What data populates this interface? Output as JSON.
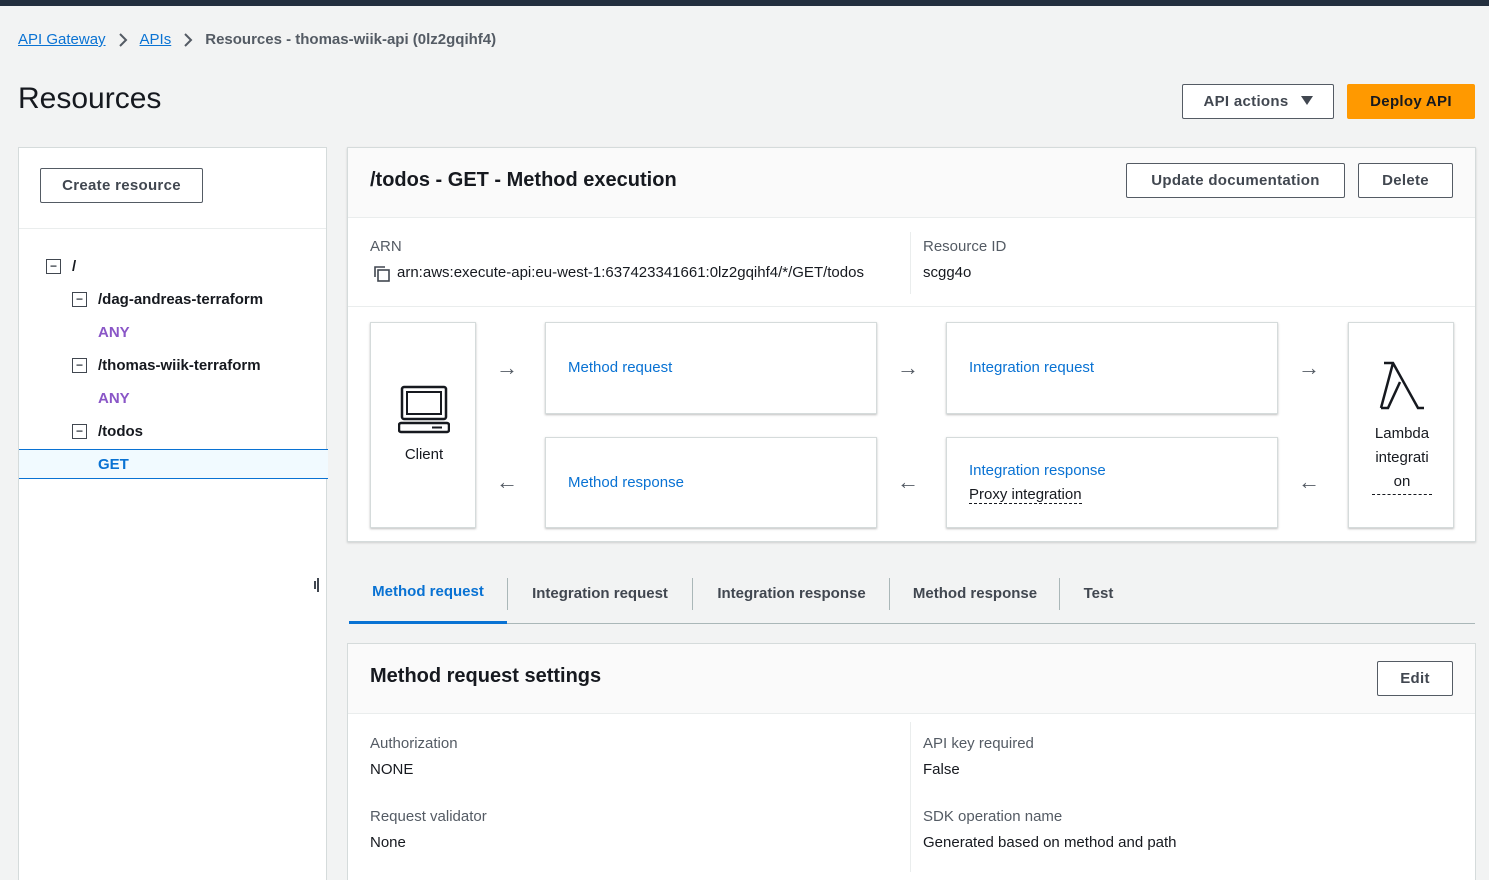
{
  "breadcrumb": {
    "items": [
      "API Gateway",
      "APIs"
    ],
    "current": "Resources - thomas-wiik-api (0lz2gqihf4)"
  },
  "page": {
    "title": "Resources",
    "api_actions_label": "API actions",
    "deploy_label": "Deploy API"
  },
  "sidebar": {
    "create_resource_label": "Create resource",
    "tree": [
      {
        "label": "/",
        "type": "resource"
      },
      {
        "label": "/dag-andreas-terraform",
        "type": "resource"
      },
      {
        "label": "ANY",
        "type": "method"
      },
      {
        "label": "/thomas-wiik-terraform",
        "type": "resource"
      },
      {
        "label": "ANY",
        "type": "method"
      },
      {
        "label": "/todos",
        "type": "resource"
      },
      {
        "label": "GET",
        "type": "method",
        "selected": true
      }
    ]
  },
  "method_execution": {
    "title": "/todos - GET - Method execution",
    "update_doc_label": "Update documentation",
    "delete_label": "Delete",
    "arn_label": "ARN",
    "arn_value": "arn:aws:execute-api:eu-west-1:637423341661:0lz2gqihf4/*/GET/todos",
    "resource_id_label": "Resource ID",
    "resource_id_value": "scgg4o",
    "flow": {
      "client_label": "Client",
      "method_request": "Method request",
      "method_response": "Method response",
      "integration_request": "Integration request",
      "integration_response": "Integration response",
      "integration_response_sub": "Proxy integration",
      "lambda_label_1": "Lambda",
      "lambda_label_2": "integrati",
      "lambda_label_3": "on"
    }
  },
  "tabs": [
    {
      "label": "Method request",
      "active": true
    },
    {
      "label": "Integration request"
    },
    {
      "label": "Integration response"
    },
    {
      "label": "Method response"
    },
    {
      "label": "Test"
    }
  ],
  "settings": {
    "title": "Method request settings",
    "edit_label": "Edit",
    "authorization_label": "Authorization",
    "authorization_value": "NONE",
    "api_key_label": "API key required",
    "api_key_value": "False",
    "validator_label": "Request validator",
    "validator_value": "None",
    "sdk_label": "SDK operation name",
    "sdk_value": "Generated based on method and path"
  },
  "colors": {
    "link": "#0972d3",
    "primary_button": "#ff9900",
    "method_badge": "#8a56c7",
    "top_bar": "#232f3e"
  },
  "icons": [
    "chevron-right-icon",
    "caret-down-icon",
    "minus-square-icon",
    "copy-icon",
    "laptop-icon",
    "lambda-icon",
    "arrow-right-icon",
    "arrow-left-icon",
    "drag-handle-icon"
  ]
}
